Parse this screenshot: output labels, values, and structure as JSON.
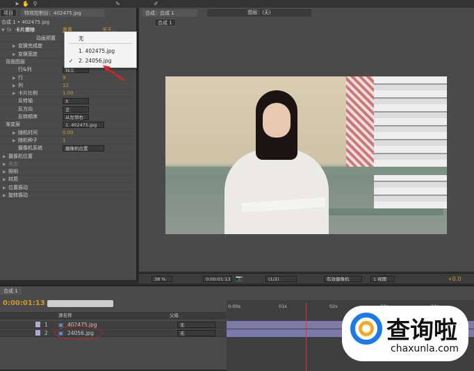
{
  "left_panel": {
    "tabs": [
      "项目",
      "特效控制台：402475.jpg"
    ],
    "breadcrumb": "合成 1 • 402475.jpg",
    "effect_name": "卡片擦除",
    "reset": "重置",
    "about": "关于...",
    "rows": [
      {
        "label": "动画预置",
        "value": ""
      },
      {
        "label": "变换完成度",
        "value": ""
      },
      {
        "label": "变换宽度",
        "value": ""
      },
      {
        "label": "背面图层",
        "value": ""
      },
      {
        "label": "行&列",
        "value": "独立"
      },
      {
        "label": "行",
        "value": "9"
      },
      {
        "label": "列",
        "value": "12"
      },
      {
        "label": "卡片比例",
        "value": "1.00"
      },
      {
        "label": "反转轴",
        "value": "X"
      },
      {
        "label": "反方向",
        "value": "正"
      },
      {
        "label": "反转顺序",
        "value": "从左到右"
      },
      {
        "label": "渐变层",
        "value": "1. 402475.jpg"
      },
      {
        "label": "随机时间",
        "value": "0.00"
      },
      {
        "label": "随机种子",
        "value": "1"
      },
      {
        "label": "摄像机系统",
        "value": "摄像机位置"
      },
      {
        "label": "摄像机位置",
        "value": ""
      },
      {
        "label": "角度",
        "value": ""
      },
      {
        "label": "照明",
        "value": ""
      },
      {
        "label": "材质",
        "value": ""
      },
      {
        "label": "位置振动",
        "value": ""
      },
      {
        "label": "旋转振动",
        "value": ""
      }
    ],
    "popup": {
      "items": [
        "无",
        "1. 402475.jpg",
        "2. 24056.jpg"
      ],
      "checked": "✓"
    }
  },
  "viewer": {
    "tab": "合成：合成 1",
    "layer_tab": "图层：(无)",
    "comp_label": "合成 1",
    "zoom": "38 %",
    "timecode": "0:00:01:13",
    "resolution": "(1/2)",
    "camera": "有效摄像机",
    "views": "1 视图",
    "exposure": "+0.0"
  },
  "timeline": {
    "tab": "合成 1",
    "timecode": "0:00:01:13",
    "col_source": "源名称",
    "col_parent": "父级",
    "ruler": [
      "0:00s",
      "01s",
      "02s",
      "03s",
      "04s"
    ],
    "layers": [
      {
        "num": "1",
        "name": "402475.jpg",
        "parent": "无"
      },
      {
        "num": "2",
        "name": "24056.jpg",
        "parent": "无"
      }
    ]
  },
  "watermark": {
    "text": "查询啦",
    "url": "chaxunla.com"
  }
}
